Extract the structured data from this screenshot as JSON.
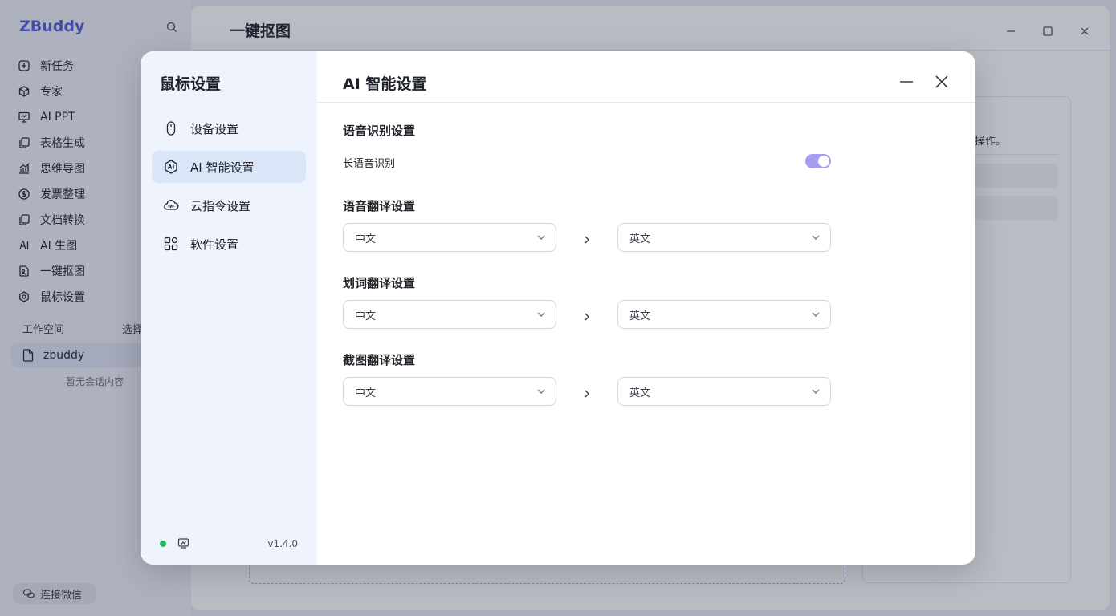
{
  "app": {
    "brand": "ZBuddy",
    "nav": [
      {
        "label": "新任务",
        "icon": "plus-square-icon"
      },
      {
        "label": "专家",
        "icon": "cube-icon"
      },
      {
        "label": "AI PPT",
        "icon": "presentation-icon"
      },
      {
        "label": "表格生成",
        "icon": "table-copy-icon"
      },
      {
        "label": "思维导图",
        "icon": "chart-growth-icon"
      },
      {
        "label": "发票整理",
        "icon": "dollar-circle-icon"
      },
      {
        "label": "文档转换",
        "icon": "document-copy-icon"
      },
      {
        "label": "AI 生图",
        "icon": "ai-image-icon"
      },
      {
        "label": "一键抠图",
        "icon": "image-cutout-icon"
      },
      {
        "label": "鼠标设置",
        "icon": "hexagon-gear-icon"
      }
    ],
    "workspace_label": "工作空间",
    "workspace_select": "选择",
    "workspace_item": "zbuddy",
    "workspace_empty": "暂无会话内容",
    "wechat_button": "连接微信",
    "main_title": "一键抠图",
    "bg_panel_text": "操作。"
  },
  "modal": {
    "sidebar_title": "鼠标设置",
    "menu": [
      {
        "label": "设备设置",
        "icon": "mouse-icon",
        "active": false
      },
      {
        "label": "AI 智能设置",
        "icon": "ai-hexagon-icon",
        "active": true
      },
      {
        "label": "云指令设置",
        "icon": "cloud-code-icon",
        "active": false
      },
      {
        "label": "软件设置",
        "icon": "apps-grid-icon",
        "active": false
      }
    ],
    "version": "v1.4.0",
    "title": "AI 智能设置",
    "sections": {
      "voice_recognition": {
        "title": "语音识别设置",
        "row_label": "长语音识别",
        "toggle_on": true
      },
      "voice_translation": {
        "title": "语音翻译设置",
        "from": "中文",
        "to": "英文"
      },
      "word_translation": {
        "title": "划词翻译设置",
        "from": "中文",
        "to": "英文"
      },
      "screenshot_translation": {
        "title": "截图翻译设置",
        "from": "中文",
        "to": "英文"
      }
    }
  },
  "colors": {
    "brand": "#4f5bd5",
    "toggle_on": "#a59ef0",
    "active_menu": "#dbe5f8",
    "status_online": "#1fba5a"
  }
}
